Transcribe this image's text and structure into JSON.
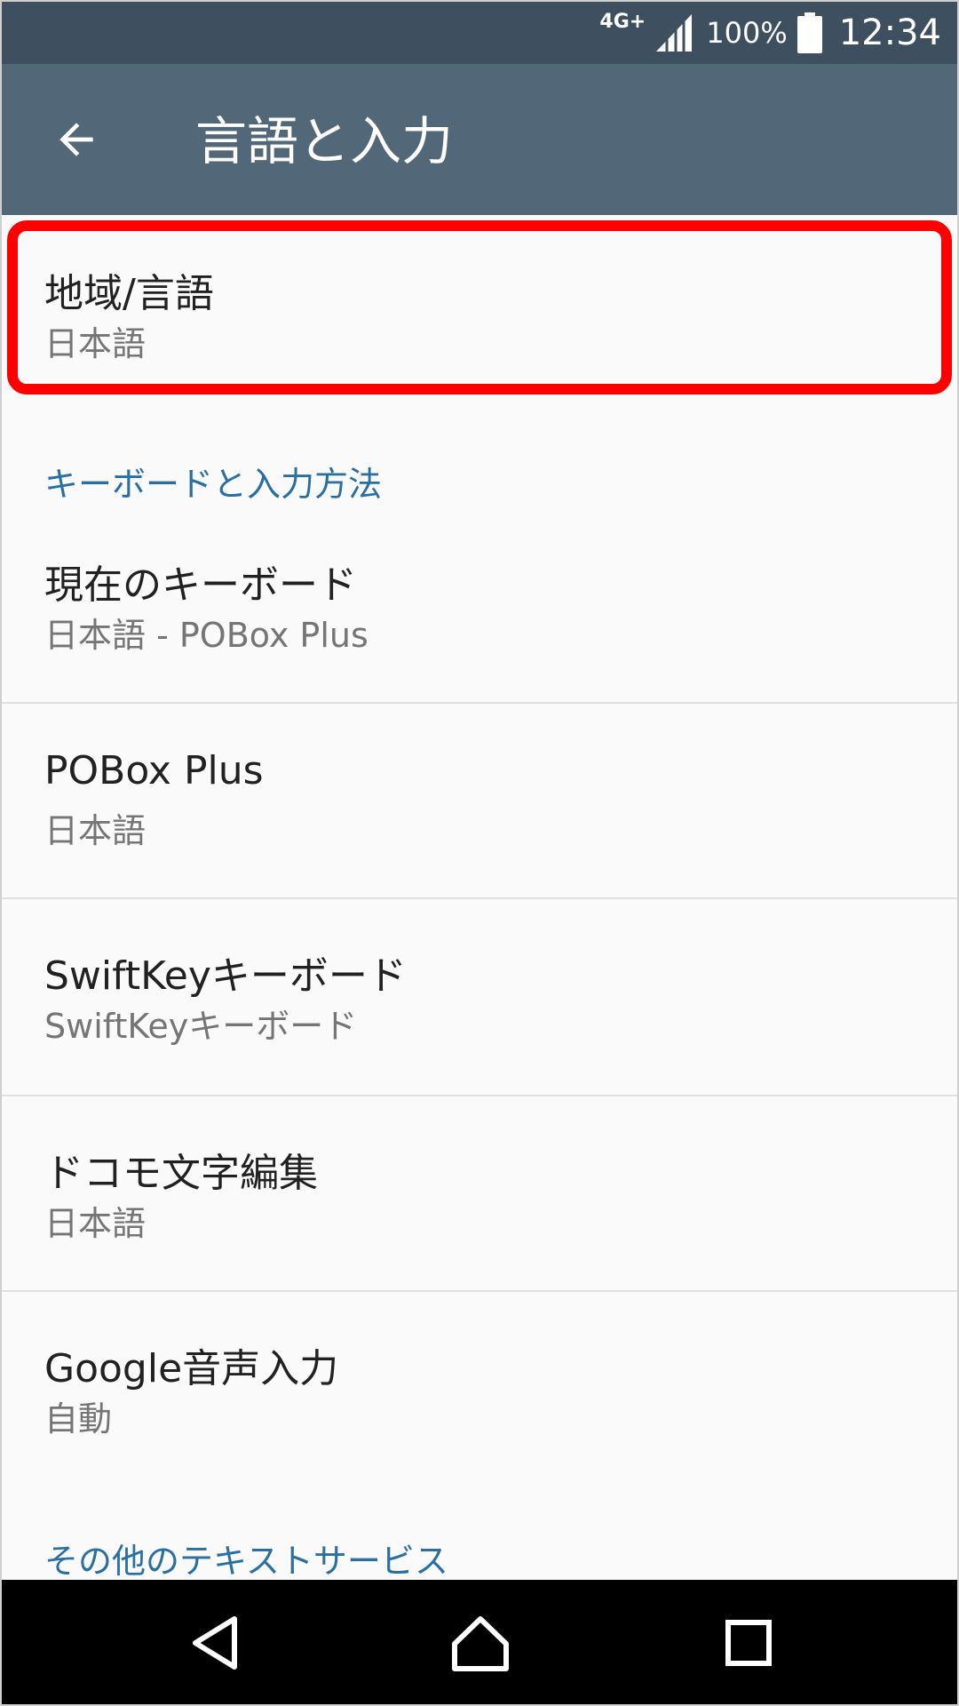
{
  "status_bar": {
    "network": "4G+",
    "battery": "100%",
    "time": "12:34"
  },
  "app_bar": {
    "title": "言語と入力"
  },
  "region_item": {
    "title": "地域/言語",
    "subtitle": "日本語"
  },
  "sections": {
    "keyboard_header": "キーボードと入力方法",
    "other_header": "その他のテキストサービス"
  },
  "keyboard_items": [
    {
      "title": "現在のキーボード",
      "subtitle": "日本語 - POBox Plus"
    },
    {
      "title": "POBox Plus",
      "subtitle": "日本語"
    },
    {
      "title": "SwiftKeyキーボード",
      "subtitle": "SwiftKeyキーボード"
    },
    {
      "title": "ドコモ文字編集",
      "subtitle": "日本語"
    },
    {
      "title": "Google音声入力",
      "subtitle": "自動"
    }
  ],
  "colors": {
    "status_bar": "#3e4f5f",
    "app_bar": "#526879",
    "section_header": "#2a6fa3",
    "highlight": "#ff0000"
  },
  "icons": {
    "back": "arrow-left-icon",
    "signal": "signal-icon",
    "battery": "battery-icon",
    "nav_back": "triangle-back-icon",
    "nav_home": "home-icon",
    "nav_recents": "square-recents-icon"
  }
}
